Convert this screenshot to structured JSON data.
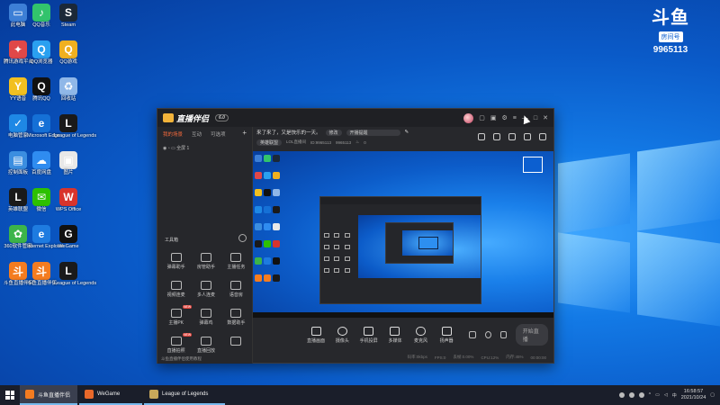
{
  "desktop": {
    "icons": [
      {
        "label": "此电脑",
        "color": "#3d7fd6",
        "glyph": "▭"
      },
      {
        "label": "QQ音乐",
        "color": "#32c36c",
        "glyph": "♪"
      },
      {
        "label": "Steam",
        "color": "#1b2838",
        "glyph": "S"
      },
      {
        "label": "腾讯游戏平台",
        "color": "#e04848",
        "glyph": "✦"
      },
      {
        "label": "QQ浏览器",
        "color": "#2aa0f0",
        "glyph": "Q"
      },
      {
        "label": "QQ游戏",
        "color": "#f0b020",
        "glyph": "Q"
      },
      {
        "label": "YY语音",
        "color": "#f2c020",
        "glyph": "Y"
      },
      {
        "label": "腾讯QQ",
        "color": "#111111",
        "glyph": "Q"
      },
      {
        "label": "回收站",
        "color": "#8fb7e8",
        "glyph": "♻"
      },
      {
        "label": "电脑管家",
        "color": "#1e88e5",
        "glyph": "✓"
      },
      {
        "label": "Microsoft Edge",
        "color": "#1570d6",
        "glyph": "e"
      },
      {
        "label": "League of Legends",
        "color": "#1a1a1a",
        "glyph": "L"
      },
      {
        "label": "控制面板",
        "color": "#3b8ee0",
        "glyph": "▤"
      },
      {
        "label": "百度网盘",
        "color": "#2f8cf0",
        "glyph": "☁"
      },
      {
        "label": "图片",
        "color": "#e8e8e8",
        "glyph": "▣"
      },
      {
        "label": "英雄联盟",
        "color": "#1a1a1a",
        "glyph": "L"
      },
      {
        "label": "微信",
        "color": "#2dc100",
        "glyph": "✉"
      },
      {
        "label": "WPS Office",
        "color": "#d8342c",
        "glyph": "W"
      },
      {
        "label": "360软件管家",
        "color": "#3cb44a",
        "glyph": "✿"
      },
      {
        "label": "Internet Explorer",
        "color": "#1e7be0",
        "glyph": "e"
      },
      {
        "label": "WeGame",
        "color": "#111111",
        "glyph": "G"
      },
      {
        "label": "斗鱼直播伴侣",
        "color": "#f47c20",
        "glyph": "斗"
      },
      {
        "label": "斗鱼直播伴侣",
        "color": "#f47c20",
        "glyph": "斗"
      },
      {
        "label": "League of Legends",
        "color": "#1a1a1a",
        "glyph": "L"
      }
    ]
  },
  "watermark": {
    "logo": "斗鱼",
    "sub": "房间号",
    "room_number": "9965113"
  },
  "app": {
    "title": "直播伴侣",
    "version": "6.0",
    "sidebar": {
      "tabs": [
        "我的场景",
        "互动",
        "可选项"
      ],
      "add": "+",
      "scene_label": "全屏 1",
      "tools_header": "工具箱",
      "tools": [
        {
          "label": "弹幕助手",
          "tag": ""
        },
        {
          "label": "房管助手",
          "tag": ""
        },
        {
          "label": "主播任务",
          "tag": ""
        },
        {
          "label": "视频连麦",
          "tag": ""
        },
        {
          "label": "多人连麦",
          "tag": ""
        },
        {
          "label": "语音房",
          "tag": ""
        },
        {
          "label": "主播PK",
          "tag": "NEW"
        },
        {
          "label": "弹幕鸡",
          "tag": ""
        },
        {
          "label": "数据助手",
          "tag": ""
        },
        {
          "label": "直播拍照",
          "tag": "NEW"
        },
        {
          "label": "直播回放",
          "tag": ""
        },
        {
          "label": "",
          "tag": ""
        }
      ],
      "footer": "斗鱼直播伴侣使用教程"
    },
    "announce": {
      "text": "来了来了，又是快乐的一天。",
      "edit": "修改",
      "notice_placeholder": "开播提醒"
    },
    "info": {
      "category": "英雄联盟",
      "room_title": "LOL直播间",
      "room_id": "ID:9965113",
      "fans": "9965113",
      "hot": "0"
    },
    "controls": [
      {
        "label": "直播画面"
      },
      {
        "label": "摄像头"
      },
      {
        "label": "手机投屏"
      },
      {
        "label": "多媒体"
      },
      {
        "label": "麦克风"
      },
      {
        "label": "扬声器"
      }
    ],
    "start_live": "开始直播",
    "status": [
      "码率:0kbps",
      "FPS:0",
      "丢帧:0.00%",
      "CPU:12%",
      "内存:45%",
      "00:00:00"
    ]
  },
  "taskbar": {
    "items": [
      {
        "label": "斗鱼直播伴侣",
        "color": "#f47c20",
        "active": true
      },
      {
        "label": "WeGame",
        "color": "#e8682a",
        "active": false
      },
      {
        "label": "League of Legends",
        "color": "#c8a85a",
        "active": false
      }
    ],
    "tray_lang": "中",
    "time": "16:58:57",
    "date": "2021/10/24"
  }
}
